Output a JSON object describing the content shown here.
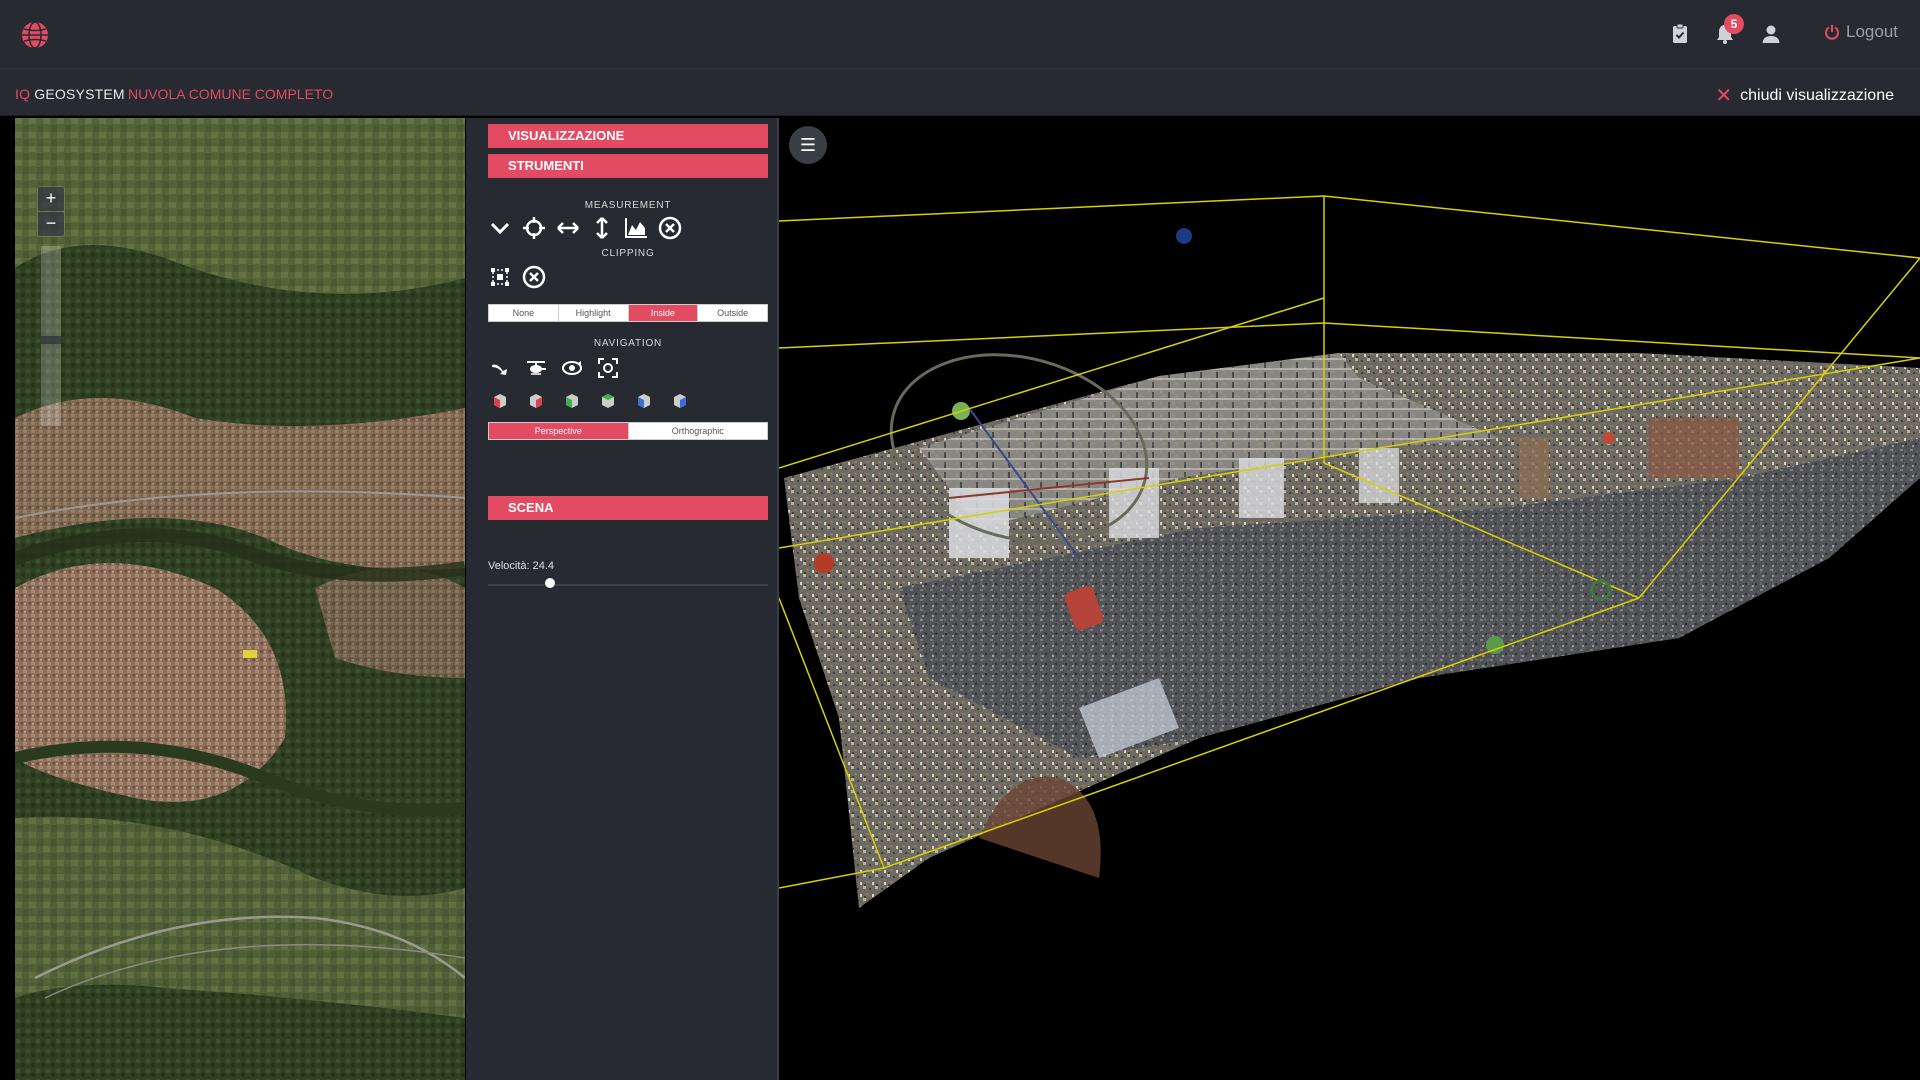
{
  "topbar": {
    "notifications_count": "5",
    "logout_label": "Logout",
    "icons": [
      "globe-logo",
      "clipboard-check-icon",
      "bell-icon",
      "user-icon",
      "power-icon"
    ]
  },
  "subbar": {
    "brand_iq": "IQ",
    "brand_name": "GEOSYSTEM",
    "project_name": "NUVOLA COMUNE COMPLETO",
    "close_label": "chiudi visualizzazione"
  },
  "map": {
    "zoom_in": "+",
    "zoom_out": "−"
  },
  "panel": {
    "visualizzazione": "VISUALIZZAZIONE",
    "strumenti": "STRUMENTI",
    "measurement_label": "MEASUREMENT",
    "clipping_label": "CLIPPING",
    "clip_modes": [
      "None",
      "Highlight",
      "Inside",
      "Outside"
    ],
    "clip_mode_selected": "Inside",
    "navigation_label": "NAVIGATION",
    "camera_modes": [
      "Perspective",
      "Orthographic"
    ],
    "camera_selected": "Perspective",
    "speed_label": "Velocità: 24.4",
    "speed_fraction": 0.22,
    "scena": "SCENA"
  },
  "viewer": {
    "menu_icon": "hamburger-icon"
  },
  "colors": {
    "accent": "#e34b63",
    "bar_bg": "#272a30",
    "bounding_box": "#d8d000"
  }
}
